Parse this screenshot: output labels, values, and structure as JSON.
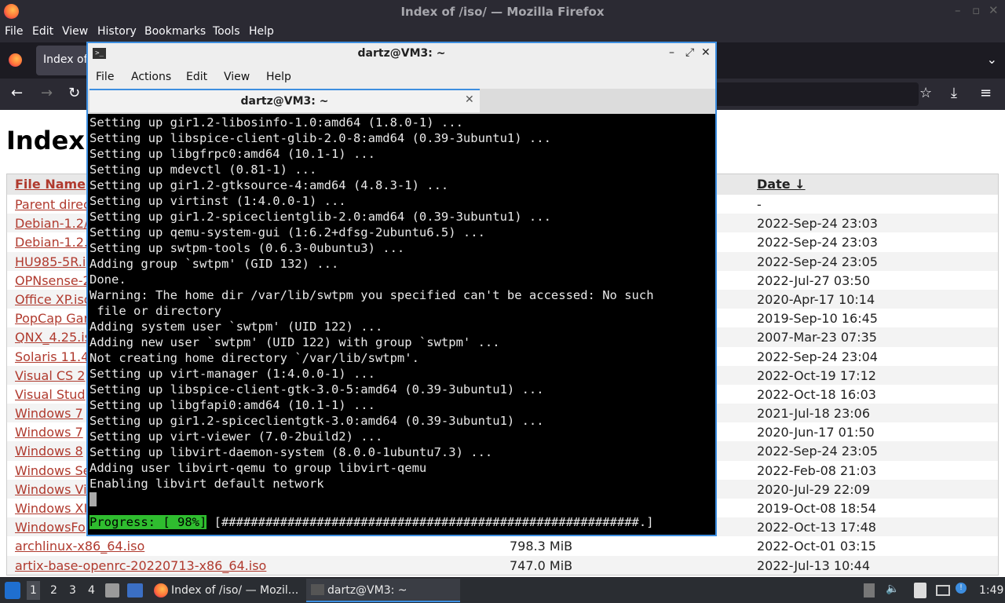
{
  "firefox": {
    "window_title": "Index of /iso/ — Mozilla Firefox",
    "menu": [
      "File",
      "Edit",
      "View",
      "History",
      "Bookmarks",
      "Tools",
      "Help"
    ],
    "tab_label": "Index of",
    "page": {
      "heading": "Index",
      "columns": {
        "name": "File Name",
        "date": "Date ↓"
      },
      "rows": [
        {
          "name": "Parent direc",
          "size": "",
          "date": "-"
        },
        {
          "name": "Debian-1.2/",
          "size": "",
          "date": "2022-Sep-24 23:03"
        },
        {
          "name": "Debian-1.2.",
          "size": "",
          "date": "2022-Sep-24 23:03"
        },
        {
          "name": "HU985-5R.i",
          "size": "",
          "date": "2022-Sep-24 23:05"
        },
        {
          "name": "OPNsense-2",
          "size": "",
          "date": "2022-Jul-27 03:50"
        },
        {
          "name": "Office XP.iso",
          "size": "",
          "date": "2020-Apr-17 10:14"
        },
        {
          "name": "PopCap Gar",
          "size": "",
          "date": "2019-Sep-10 16:45"
        },
        {
          "name": "QNX_4.25.is",
          "size": "",
          "date": "2007-Mar-23 07:35"
        },
        {
          "name": "Solaris 11.4",
          "size": "",
          "date": "2022-Sep-24 23:04"
        },
        {
          "name": "Visual CS 2",
          "size": "",
          "date": "2022-Oct-19 17:12"
        },
        {
          "name": "Visual Stud",
          "size": "",
          "date": "2022-Oct-18 16:03"
        },
        {
          "name": "Windows 7",
          "size": "",
          "date": "2021-Jul-18 23:06"
        },
        {
          "name": "Windows 7",
          "size": "",
          "date": "2020-Jun-17 01:50"
        },
        {
          "name": "Windows 8",
          "size": "",
          "date": "2022-Sep-24 23:05"
        },
        {
          "name": "Windows Se",
          "size": "",
          "date": "2022-Feb-08 21:03"
        },
        {
          "name": "Windows Vi",
          "size": "",
          "date": "2020-Jul-29 22:09"
        },
        {
          "name": "Windows XI",
          "size": "",
          "date": "2019-Oct-08 18:54"
        },
        {
          "name": "WindowsFo",
          "size": "",
          "date": "2022-Oct-13 17:48"
        },
        {
          "name": "archlinux-x86_64.iso",
          "size": "798.3 MiB",
          "date": "2022-Oct-01 03:15"
        },
        {
          "name": "artix-base-openrc-20220713-x86_64.iso",
          "size": "747.0 MiB",
          "date": "2022-Jul-13 10:44"
        }
      ]
    }
  },
  "terminal": {
    "title": "dartz@VM3: ~",
    "menu": [
      "File",
      "Actions",
      "Edit",
      "View",
      "Help"
    ],
    "tab_title": "dartz@VM3: ~",
    "lines": [
      "Setting up gir1.2-libosinfo-1.0:amd64 (1.8.0-1) ...",
      "Setting up libspice-client-glib-2.0-8:amd64 (0.39-3ubuntu1) ...",
      "Setting up libgfrpc0:amd64 (10.1-1) ...",
      "Setting up mdevctl (0.81-1) ...",
      "Setting up gir1.2-gtksource-4:amd64 (4.8.3-1) ...",
      "Setting up virtinst (1:4.0.0-1) ...",
      "Setting up gir1.2-spiceclientglib-2.0:amd64 (0.39-3ubuntu1) ...",
      "Setting up qemu-system-gui (1:6.2+dfsg-2ubuntu6.5) ...",
      "Setting up swtpm-tools (0.6.3-0ubuntu3) ...",
      "Adding group `swtpm' (GID 132) ...",
      "Done.",
      "Warning: The home dir /var/lib/swtpm you specified can't be accessed: No such",
      " file or directory",
      "Adding system user `swtpm' (UID 122) ...",
      "Adding new user `swtpm' (UID 122) with group `swtpm' ...",
      "Not creating home directory `/var/lib/swtpm'.",
      "Setting up virt-manager (1:4.0.0-1) ...",
      "Setting up libspice-client-gtk-3.0-5:amd64 (0.39-3ubuntu1) ...",
      "Setting up libgfapi0:amd64 (10.1-1) ...",
      "Setting up gir1.2-spiceclientgtk-3.0:amd64 (0.39-3ubuntu1) ...",
      "Setting up virt-viewer (7.0-2build2) ...",
      "Setting up libvirt-daemon-system (8.0.0-1ubuntu7.3) ...",
      "Adding user libvirt-qemu to group libvirt-qemu",
      "Enabling libvirt default network"
    ],
    "progress_label": "Progress: [ 98%]",
    "progress_bar": " [#########################################################.]",
    "progress_percent": 98
  },
  "taskbar": {
    "workspaces": [
      "1",
      "2",
      "3",
      "4"
    ],
    "tasks": [
      {
        "label": "Index of /iso/ — Mozil..."
      },
      {
        "label": "dartz@VM3: ~"
      }
    ],
    "clock": "1:49"
  },
  "colors": {
    "link": "#b03a2e",
    "terminal_border": "#3d8ee0",
    "progress_green": "#2fbd2f"
  }
}
